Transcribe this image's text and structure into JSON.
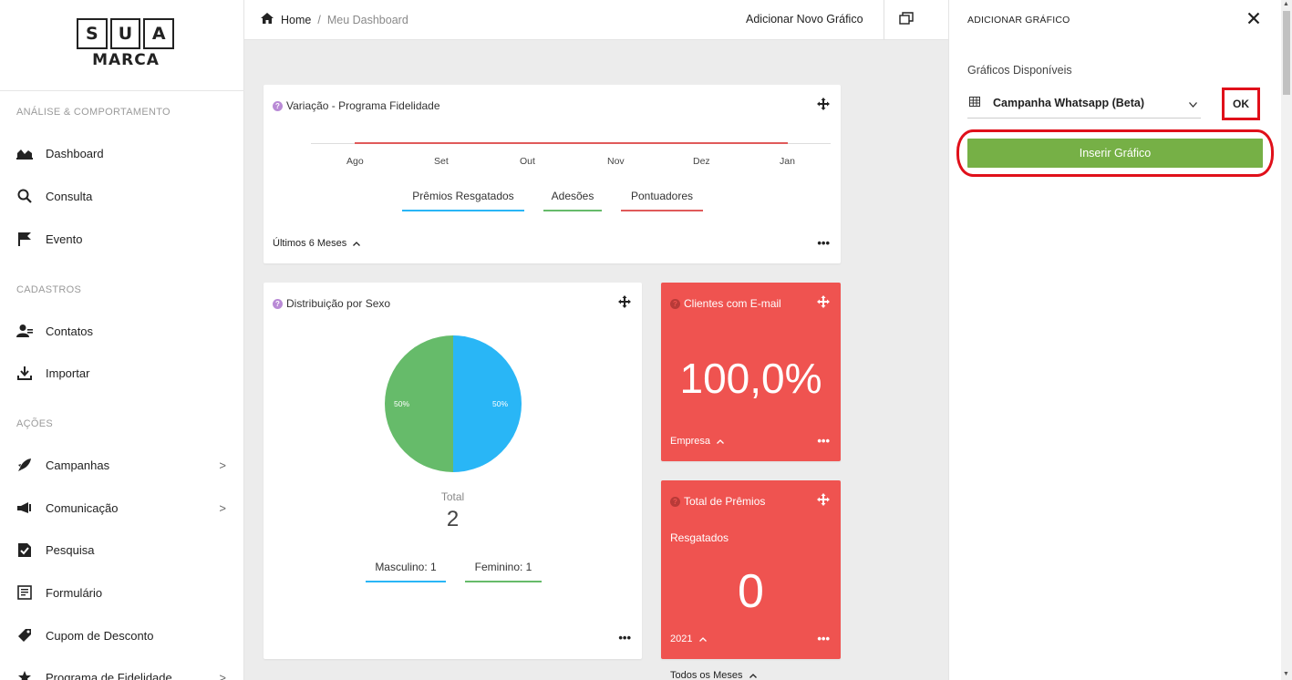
{
  "logo": {
    "letters": [
      "S",
      "U",
      "A"
    ],
    "word": "MARCA"
  },
  "sidebar": {
    "sections": [
      {
        "title": "ANÁLISE & COMPORTAMENTO"
      },
      {
        "title": "CADASTROS"
      },
      {
        "title": "AÇÕES"
      }
    ],
    "items": [
      {
        "label": "Dashboard",
        "icon": "chart-area-icon"
      },
      {
        "label": "Consulta",
        "icon": "search-icon"
      },
      {
        "label": "Evento",
        "icon": "flag-icon"
      },
      {
        "label": "Contatos",
        "icon": "contacts-icon"
      },
      {
        "label": "Importar",
        "icon": "download-icon"
      },
      {
        "label": "Campanhas",
        "icon": "rocket-icon",
        "chevron": ">"
      },
      {
        "label": "Comunicação",
        "icon": "megaphone-icon",
        "chevron": ">"
      },
      {
        "label": "Pesquisa",
        "icon": "survey-icon"
      },
      {
        "label": "Formulário",
        "icon": "form-icon"
      },
      {
        "label": "Cupom de Desconto",
        "icon": "tag-icon"
      },
      {
        "label": "Programa de Fidelidade",
        "icon": "star-icon",
        "chevron": ">"
      }
    ]
  },
  "topbar": {
    "breadcrumb": {
      "home": "Home",
      "separator": "/",
      "current": "Meu Dashboard"
    },
    "add_chart": "Adicionar Novo Gráfico"
  },
  "cards": {
    "loyalty": {
      "title": "Variação - Programa Fidelidade",
      "months": [
        "Ago",
        "Set",
        "Out",
        "Nov",
        "Dez",
        "Jan"
      ],
      "legend": [
        {
          "label": "Prêmios Resgatados",
          "color": "#29b6f6"
        },
        {
          "label": "Adesões",
          "color": "#66bb6a"
        },
        {
          "label": "Pontuadores",
          "color": "#e05a5a"
        }
      ],
      "period": "Últimos 6 Meses",
      "more": "•••"
    },
    "gender": {
      "title": "Distribuição por Sexo",
      "slices": [
        {
          "label": "50%",
          "value": 50,
          "color": "#29b6f6"
        },
        {
          "label": "50%",
          "value": 50,
          "color": "#66bb6a"
        }
      ],
      "total_label": "Total",
      "total_value": "2",
      "legend": [
        {
          "label": "Masculino: 1",
          "color": "#29b6f6"
        },
        {
          "label": "Feminino: 1",
          "color": "#66bb6a"
        }
      ],
      "more": "•••"
    },
    "email": {
      "title": "Clientes com E-mail",
      "value": "100,0%",
      "period": "Empresa",
      "more": "•••",
      "color": "#ef5350"
    },
    "prizes": {
      "title": "Total de Prêmios",
      "subtitle": "Resgatados",
      "value": "0",
      "period": "2021",
      "more": "•••",
      "color": "#ef5350"
    },
    "next_period": "Todos os Meses"
  },
  "panel": {
    "title": "ADICIONAR GRÁFICO",
    "available_label": "Gráficos Disponíveis",
    "selected_chart": "Campanha Whatsapp (Beta)",
    "ok_label": "OK",
    "insert_label": "Inserir Gráfico",
    "insert_color": "#76b046",
    "highlight_color": "#e0101a"
  }
}
